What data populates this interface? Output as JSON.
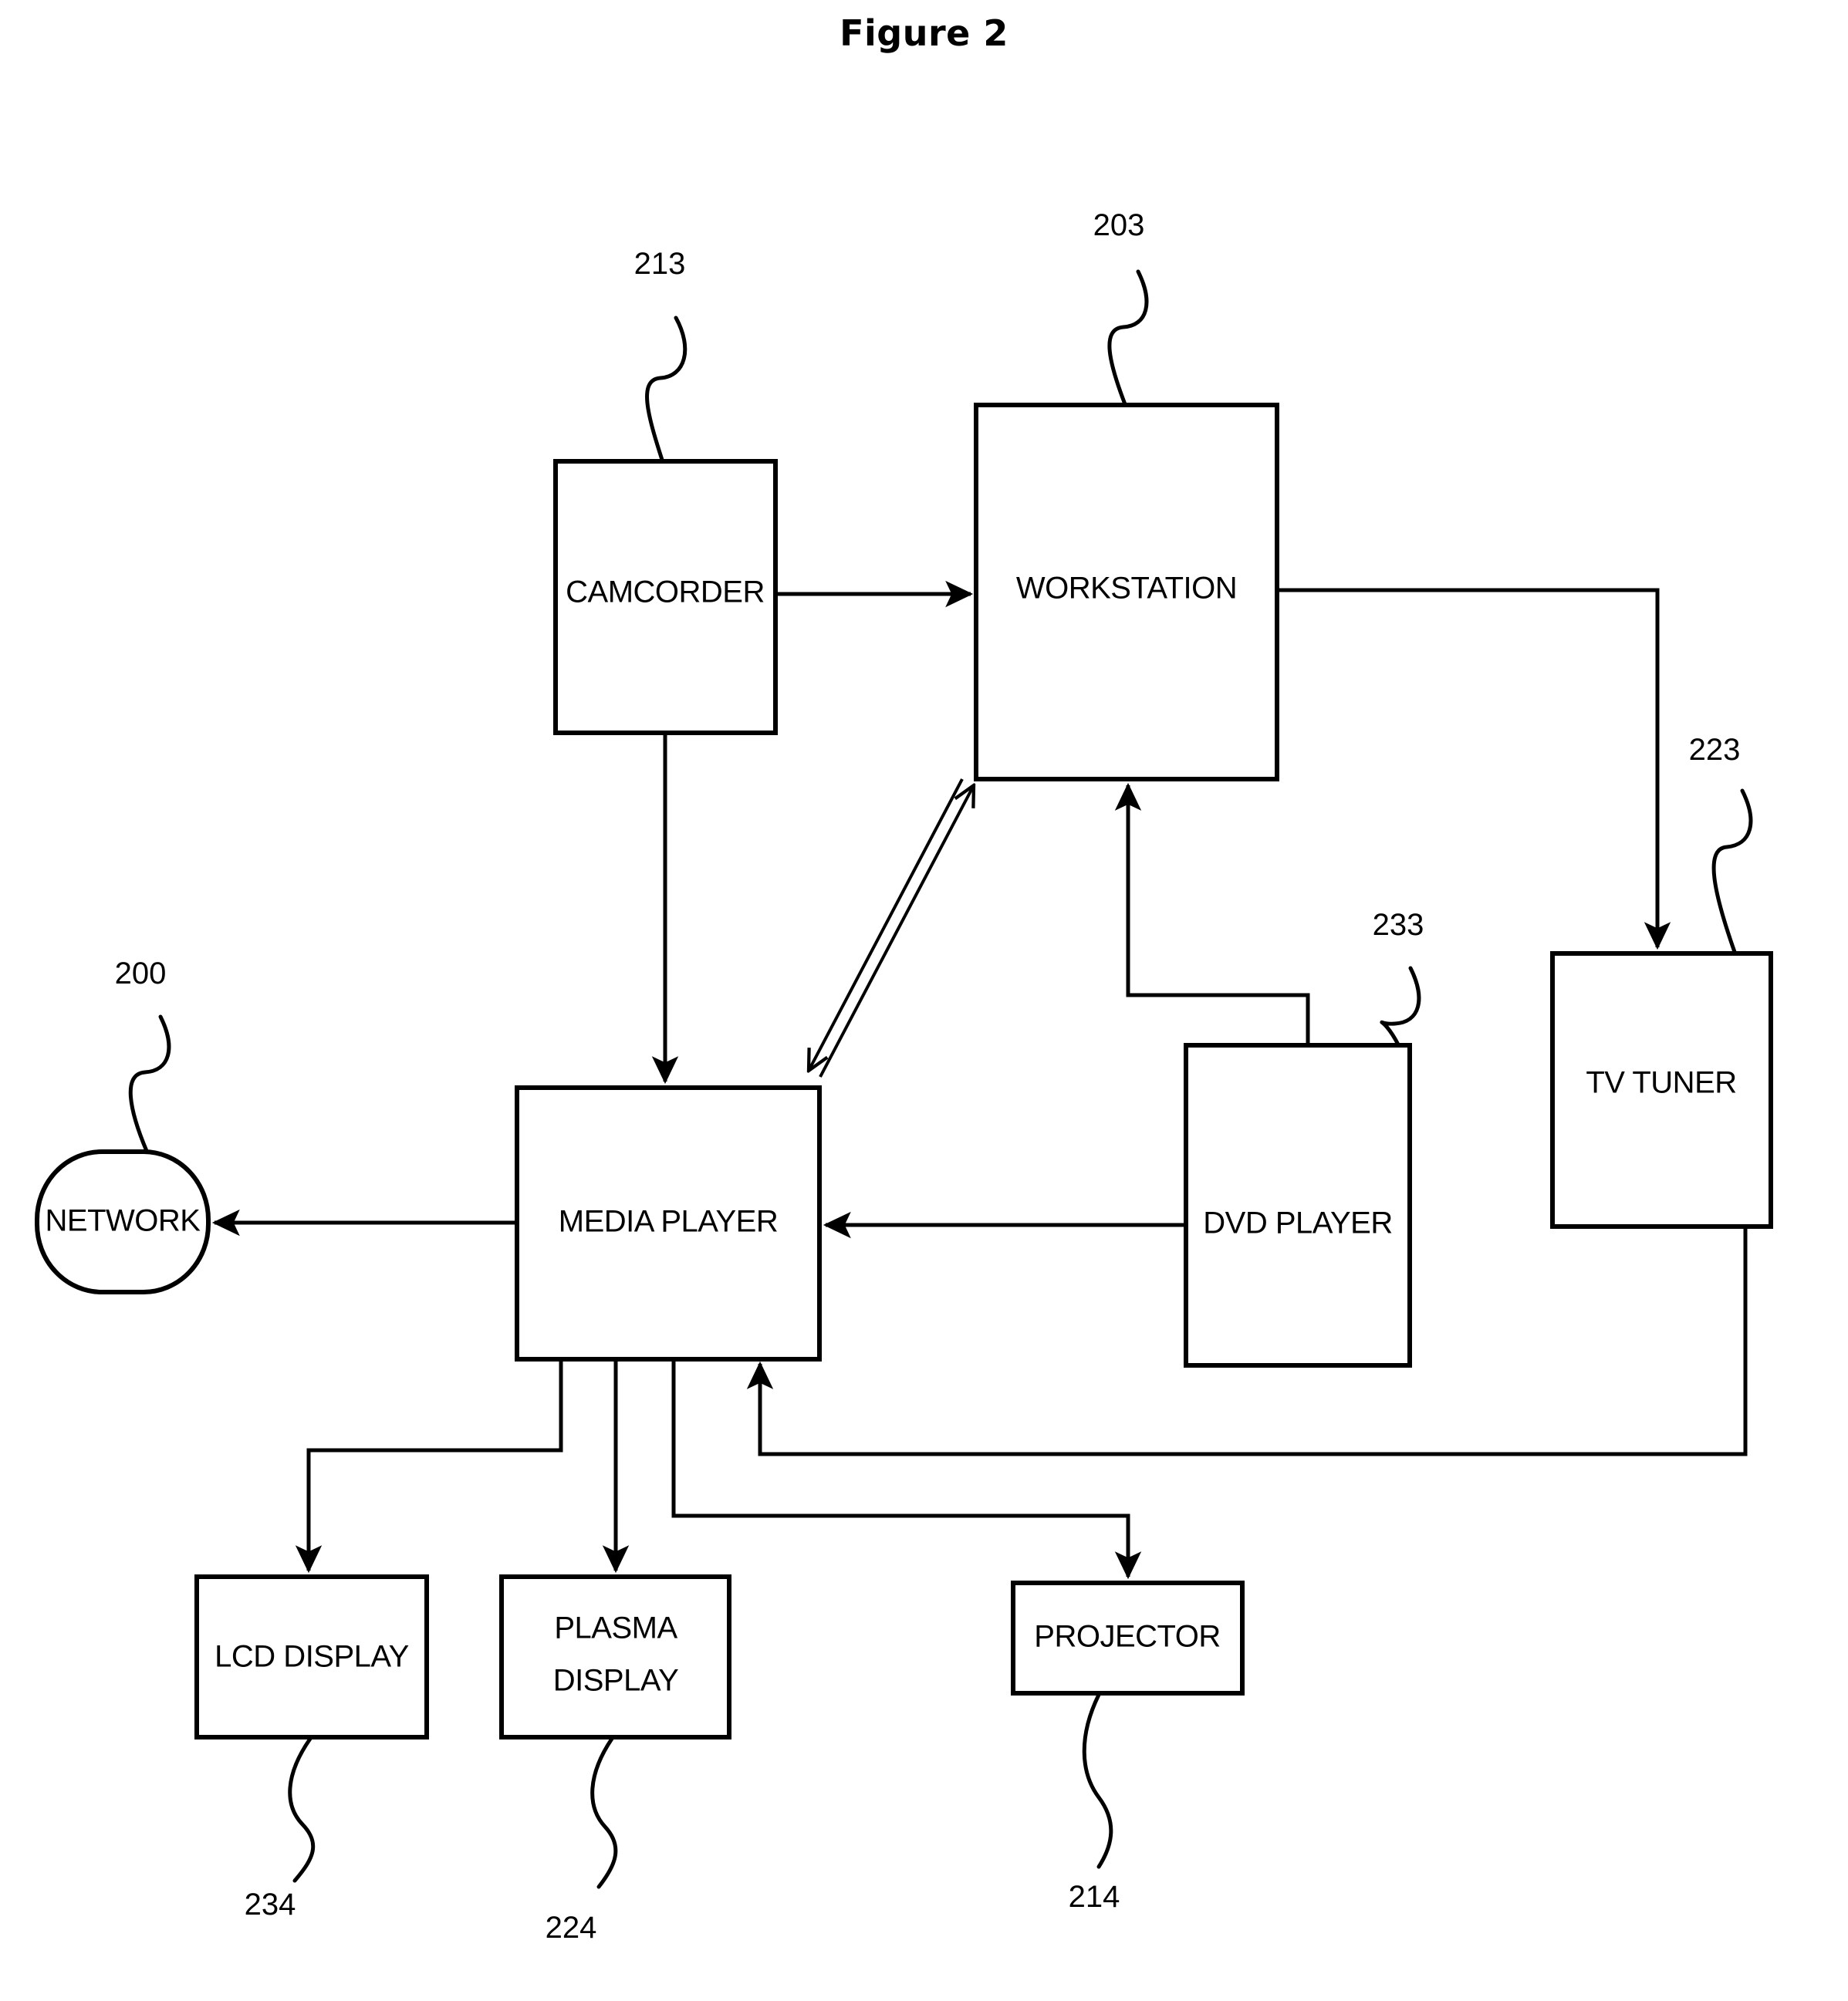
{
  "figure": {
    "title": "Figure 2"
  },
  "nodes": [
    {
      "id": "camcorder",
      "label": "CAMCORDER",
      "shape": "rect",
      "ref": "213"
    },
    {
      "id": "workstation",
      "label": "WORKSTATION",
      "shape": "rect",
      "ref": "203"
    },
    {
      "id": "network",
      "label": "NETWORK",
      "shape": "rounded",
      "ref": "200"
    },
    {
      "id": "media-player",
      "label": "MEDIA PLAYER",
      "shape": "rect",
      "ref": ""
    },
    {
      "id": "dvd-player",
      "label": "DVD PLAYER",
      "shape": "rect",
      "ref": "233"
    },
    {
      "id": "tv-tuner",
      "label": "TV TUNER",
      "shape": "rect",
      "ref": "223"
    },
    {
      "id": "lcd-display",
      "label": "LCD DISPLAY",
      "shape": "rect",
      "ref": "234"
    },
    {
      "id": "plasma-display",
      "label_line1": "PLASMA",
      "label_line2": "DISPLAY",
      "label": "PLASMA DISPLAY",
      "shape": "rect",
      "ref": "224"
    },
    {
      "id": "projector",
      "label": "PROJECTOR",
      "shape": "rect",
      "ref": "214"
    }
  ],
  "reference_numerals": {
    "network": "200",
    "workstation": "203",
    "camcorder": "213",
    "projector": "214",
    "tv_tuner": "223",
    "plasma_display": "224",
    "dvd_player": "233",
    "lcd_display": "234"
  },
  "labels": {
    "camcorder": "CAMCORDER",
    "workstation": "WORKSTATION",
    "network": "NETWORK",
    "media_player": "MEDIA PLAYER",
    "dvd_player": "DVD PLAYER",
    "tv_tuner": "TV TUNER",
    "lcd_display": "LCD DISPLAY",
    "plasma_display_line1": "PLASMA",
    "plasma_display_line2": "DISPLAY",
    "projector": "PROJECTOR"
  },
  "connections": [
    {
      "from": "camcorder",
      "to": "workstation",
      "style": "solid-arrow",
      "direction": "one-way"
    },
    {
      "from": "camcorder",
      "to": "media-player",
      "style": "solid-arrow",
      "direction": "one-way"
    },
    {
      "from": "media-player",
      "to": "workstation",
      "style": "hollow-arrow",
      "direction": "two-way"
    },
    {
      "from": "media-player",
      "to": "network",
      "style": "solid-arrow",
      "direction": "one-way"
    },
    {
      "from": "dvd-player",
      "to": "workstation",
      "style": "solid-arrow",
      "direction": "one-way"
    },
    {
      "from": "dvd-player",
      "to": "media-player",
      "style": "solid-arrow",
      "direction": "one-way"
    },
    {
      "from": "workstation",
      "to": "tv-tuner",
      "style": "solid-arrow",
      "direction": "one-way"
    },
    {
      "from": "tv-tuner",
      "to": "media-player",
      "style": "solid-arrow",
      "direction": "one-way"
    },
    {
      "from": "media-player",
      "to": "lcd-display",
      "style": "solid-arrow",
      "direction": "one-way"
    },
    {
      "from": "media-player",
      "to": "plasma-display",
      "style": "solid-arrow",
      "direction": "one-way"
    },
    {
      "from": "media-player",
      "to": "projector",
      "style": "solid-arrow",
      "direction": "one-way"
    }
  ],
  "colors": {
    "line": "#000000",
    "background": "#ffffff"
  }
}
